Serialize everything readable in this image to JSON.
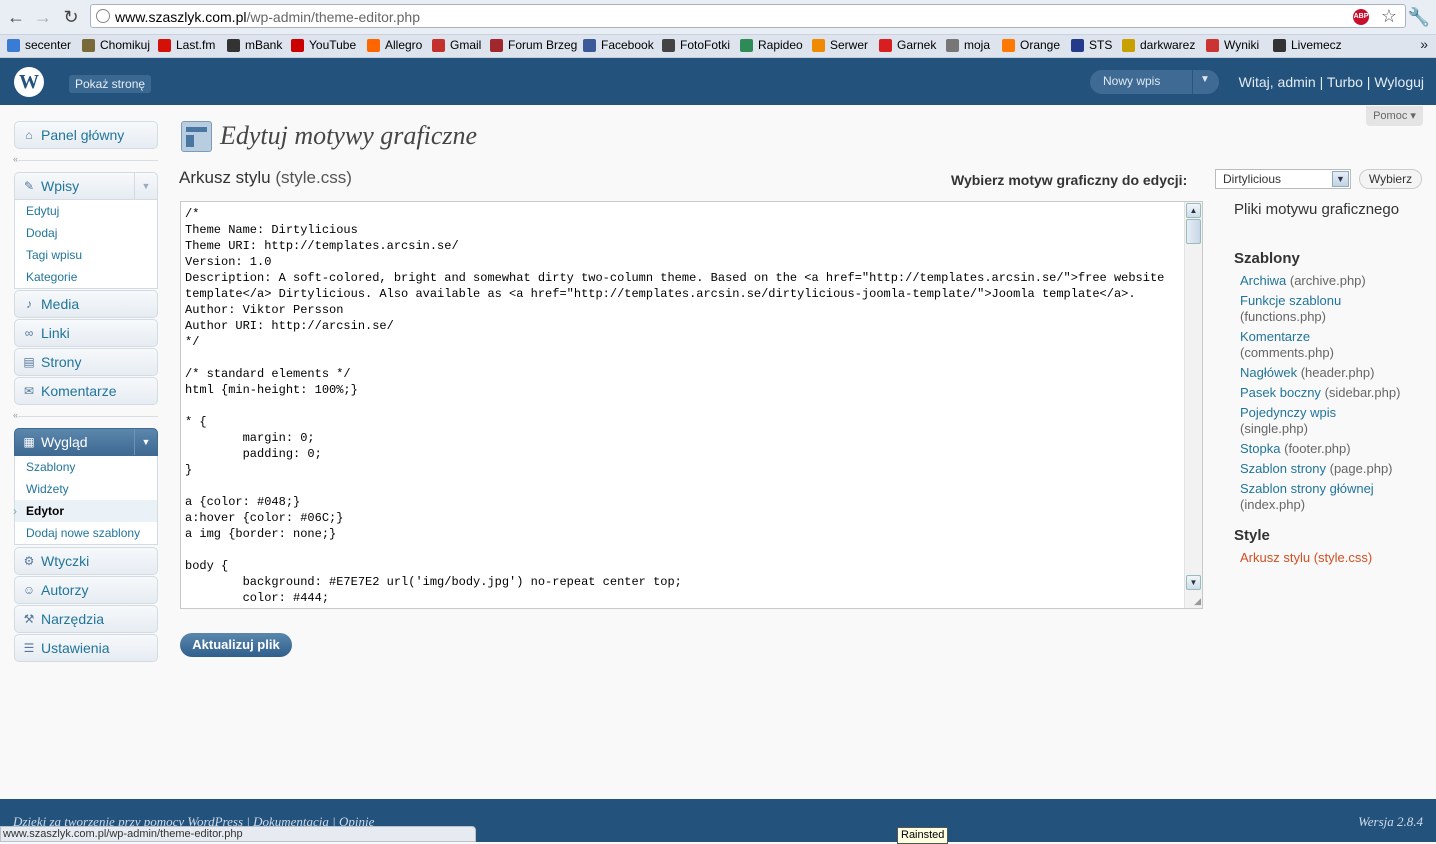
{
  "browser": {
    "back_glyph": "←",
    "forward_glyph": "→",
    "reload_glyph": "↻",
    "url_domain": "www.szaszlyk.com.pl",
    "url_path": "/wp-admin/theme-editor.php",
    "abp_label": "ABP",
    "star_glyph": "☆",
    "wrench_glyph": "🔧",
    "bookmarks": [
      {
        "label": "secenter",
        "color": "#3a7bd5"
      },
      {
        "label": "Chomikuj",
        "color": "#7a6a3a"
      },
      {
        "label": "Last.fm",
        "color": "#d51007"
      },
      {
        "label": "mBank",
        "color": "#333333"
      },
      {
        "label": "YouTube",
        "color": "#cc0000"
      },
      {
        "label": "Allegro",
        "color": "#ff6600"
      },
      {
        "label": "Gmail",
        "color": "#c4302b"
      },
      {
        "label": "Forum Brzeg",
        "color": "#a0272d"
      },
      {
        "label": "Facebook",
        "color": "#3b5998"
      },
      {
        "label": "FotoFotki",
        "color": "#444444"
      },
      {
        "label": "Rapideo",
        "color": "#2e8b57"
      },
      {
        "label": "Serwer",
        "color": "#f08a00"
      },
      {
        "label": "Garnek",
        "color": "#d81e1e"
      },
      {
        "label": "moja",
        "color": "#777777"
      },
      {
        "label": "Orange",
        "color": "#ff7900"
      },
      {
        "label": "STS",
        "color": "#243b8c"
      },
      {
        "label": "darkwarez",
        "color": "#c8a000"
      },
      {
        "label": "Wyniki",
        "color": "#cc3333"
      },
      {
        "label": "Livemecz",
        "color": "#333333"
      }
    ],
    "more_glyph": "»",
    "status_url": "www.szaszlyk.com.pl/wp-admin/theme-editor.php",
    "taskbar_tooltip": "Rainsted"
  },
  "header": {
    "logo_glyph": "W",
    "site_button": "Pokaż stronę",
    "new_post": "Nowy wpis",
    "new_post_arrow": "▼",
    "greeting": "Witaj, ",
    "user": "admin",
    "separator": "|",
    "turbo": "Turbo",
    "logout": "Wyloguj"
  },
  "menu": {
    "dashboard": {
      "label": "Panel główny",
      "icon": "⌂"
    },
    "posts": {
      "label": "Wpisy",
      "icon": "✎",
      "arrow": "▼",
      "items": [
        "Edytuj",
        "Dodaj",
        "Tagi wpisu",
        "Kategorie"
      ]
    },
    "media": {
      "label": "Media",
      "icon": "♪"
    },
    "links": {
      "label": "Linki",
      "icon": "∞"
    },
    "pages": {
      "label": "Strony",
      "icon": "▤"
    },
    "comments": {
      "label": "Komentarze",
      "icon": "✉"
    },
    "appearance": {
      "label": "Wygląd",
      "icon": "▦",
      "arrow": "▼",
      "items": [
        "Szablony",
        "Widżety",
        "Edytor",
        "Dodaj nowe szablony"
      ]
    },
    "plugins": {
      "label": "Wtyczki",
      "icon": "⚙"
    },
    "users": {
      "label": "Autorzy",
      "icon": "☺"
    },
    "tools": {
      "label": "Narzędzia",
      "icon": "⚒"
    },
    "settings": {
      "label": "Ustawienia",
      "icon": "☰"
    },
    "collapse_glyph": "«"
  },
  "main": {
    "title": "Edytuj motywy graficzne",
    "help": "Pomoc ▾",
    "file_heading": "Arkusz stylu",
    "file_name": "(style.css)",
    "select_label": "Wybierz motyw graficzny do edycji:",
    "selected_theme": "Dirtylicious",
    "select_arrow": "▼",
    "choose_button": "Wybierz",
    "code": "/*\nTheme Name: Dirtylicious\nTheme URI: http://templates.arcsin.se/\nVersion: 1.0\nDescription: A soft-colored, bright and somewhat dirty two-column theme. Based on the <a href=\"http://templates.arcsin.se/\">free website\ntemplate</a> Dirtylicious. Also available as <a href=\"http://templates.arcsin.se/dirtylicious-joomla-template/\">Joomla template</a>.\nAuthor: Viktor Persson\nAuthor URI: http://arcsin.se/\n*/\n\n/* standard elements */\nhtml {min-height: 100%;}\n\n* {\n\tmargin: 0;\n\tpadding: 0;\n}\n\na {color: #048;}\na:hover {color: #06C;}\na img {border: none;}\n\nbody {\n\tbackground: #E7E7E2 url('img/body.jpg') no-repeat center top;\n\tcolor: #444;",
    "scroll_up": "▲",
    "scroll_down": "▼",
    "grip": "◢",
    "update_button": "Aktualizuj plik"
  },
  "files": {
    "title": "Pliki motywu graficznego",
    "templates_heading": "Szablony",
    "templates": [
      {
        "label": "Archiwa",
        "file": "(archive.php)"
      },
      {
        "label": "Funkcje szablonu",
        "file": "(functions.php)"
      },
      {
        "label": "Komentarze",
        "file": "(comments.php)"
      },
      {
        "label": "Nagłówek",
        "file": "(header.php)"
      },
      {
        "label": "Pasek boczny",
        "file": "(sidebar.php)"
      },
      {
        "label": "Pojedynczy wpis",
        "file": "(single.php)"
      },
      {
        "label": "Stopka",
        "file": "(footer.php)"
      },
      {
        "label": "Szablon strony",
        "file": "(page.php)"
      },
      {
        "label": "Szablon strony głównej",
        "file": "(index.php)"
      }
    ],
    "styles_heading": "Style",
    "styles": [
      {
        "label": "Arkusz stylu",
        "file": "(style.css)"
      }
    ]
  },
  "footer": {
    "thanks": "Dzięki za tworzenie przy pomocy",
    "wordpress": "WordPress",
    "docs": "Dokumentacja",
    "feedback": "Opinie",
    "version": "Wersja 2.8.4"
  }
}
